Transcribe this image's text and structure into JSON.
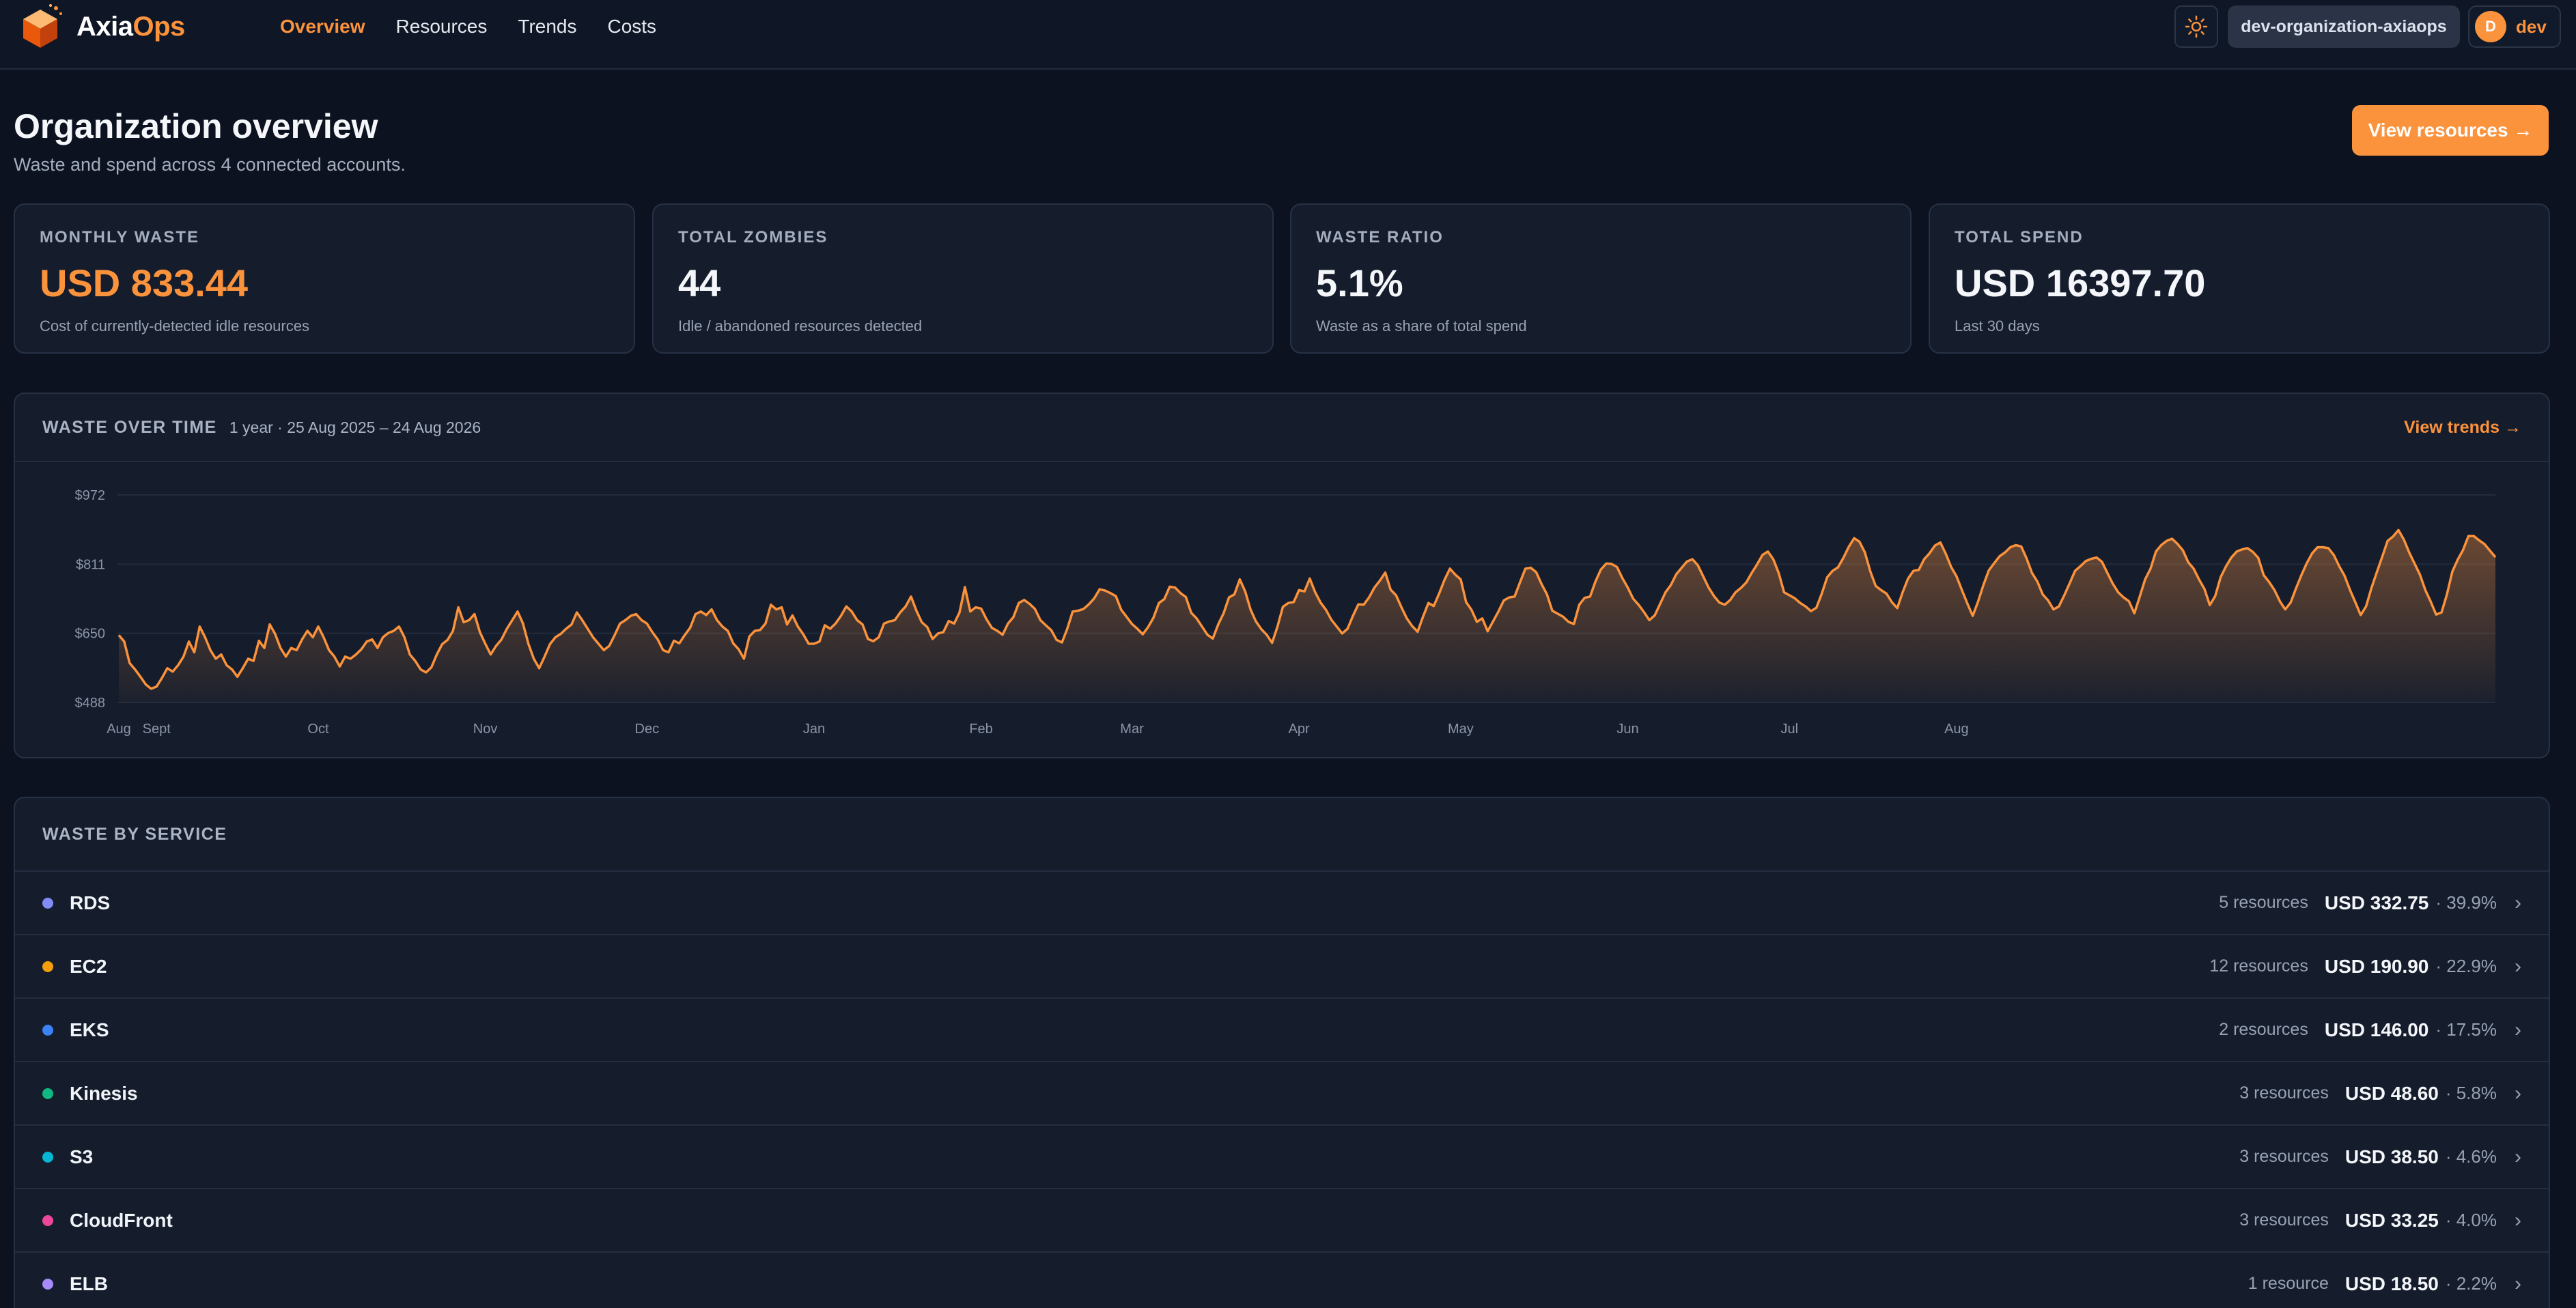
{
  "app": {
    "name_part1": "Axia",
    "name_part2": "Ops"
  },
  "nav": [
    {
      "label": "Overview",
      "active": true
    },
    {
      "label": "Resources",
      "active": false
    },
    {
      "label": "Trends",
      "active": false
    },
    {
      "label": "Costs",
      "active": false
    }
  ],
  "header": {
    "org": "dev-organization-axiaops",
    "user_initial": "D",
    "user_name": "dev",
    "theme_icon": "sun-icon"
  },
  "page": {
    "title": "Organization overview",
    "subtitle": "Waste and spend across 4 connected accounts.",
    "action": "View resources →"
  },
  "stats": [
    {
      "label": "MONTHLY WASTE",
      "value": "USD 833.44",
      "note": "Cost of currently-detected idle resources",
      "highlight": true
    },
    {
      "label": "TOTAL ZOMBIES",
      "value": "44",
      "note": "Idle / abandoned resources detected",
      "highlight": false
    },
    {
      "label": "WASTE RATIO",
      "value": "5.1%",
      "note": "Waste as a share of total spend",
      "highlight": false
    },
    {
      "label": "TOTAL SPEND",
      "value": "USD 16397.70",
      "note": "Last 30 days",
      "highlight": false
    }
  ],
  "chart_panel": {
    "title": "WASTE OVER TIME",
    "range": "1 year · 25 Aug 2025 – 24 Aug 2026",
    "link": "View trends →"
  },
  "chart_data": {
    "type": "area",
    "title": "WASTE OVER TIME",
    "y_ticks": [
      "$972",
      "$811",
      "$650",
      "$488"
    ],
    "ylim": [
      488,
      972
    ],
    "x_ticks": [
      {
        "label": "Aug",
        "day": 0
      },
      {
        "label": "Sept",
        "day": 7
      },
      {
        "label": "Oct",
        "day": 37
      },
      {
        "label": "Nov",
        "day": 68
      },
      {
        "label": "Dec",
        "day": 98
      },
      {
        "label": "Jan",
        "day": 129
      },
      {
        "label": "Feb",
        "day": 160
      },
      {
        "label": "Mar",
        "day": 188
      },
      {
        "label": "Apr",
        "day": 219
      },
      {
        "label": "May",
        "day": 249
      },
      {
        "label": "Jun",
        "day": 280
      },
      {
        "label": "Jul",
        "day": 310
      },
      {
        "label": "Aug",
        "day": 341
      }
    ],
    "series": [
      {
        "color": "#fb923c",
        "values": [
          645,
          630,
          580,
          565,
          548,
          530,
          520,
          525,
          545,
          568,
          560,
          575,
          595,
          630,
          605,
          665,
          640,
          610,
          590,
          600,
          575,
          565,
          548,
          568,
          590,
          585,
          632,
          615,
          670,
          648,
          615,
          595,
          615,
          610,
          635,
          655,
          640,
          665,
          640,
          610,
          595,
          572,
          595,
          590,
          600,
          612,
          630,
          635,
          615,
          640,
          650,
          655,
          665,
          640,
          600,
          585,
          565,
          558,
          570,
          600,
          624,
          634,
          655,
          710,
          675,
          680,
          694,
          652,
          625,
          600,
          620,
          635,
          660,
          680,
          700,
          672,
          625,
          590,
          568,
          595,
          624,
          640,
          648,
          660,
          670,
          698,
          680,
          660,
          640,
          625,
          610,
          620,
          645,
          672,
          680,
          690,
          694,
          680,
          672,
          652,
          635,
          610,
          605,
          632,
          626,
          645,
          662,
          694,
          700,
          692,
          705,
          680,
          665,
          655,
          626,
          612,
          590,
          642,
          655,
          657,
          672,
          716,
          705,
          710,
          670,
          691,
          665,
          647,
          625,
          625,
          630,
          668,
          660,
          672,
          690,
          712,
          700,
          680,
          670,
          636,
          631,
          640,
          672,
          677,
          680,
          698,
          712,
          735,
          702,
          675,
          664,
          636,
          649,
          652,
          678,
          672,
          698,
          757,
          700,
          710,
          707,
          682,
          662,
          655,
          646,
          672,
          687,
          720,
          727,
          718,
          706,
          680,
          668,
          657,
          634,
          628,
          660,
          700,
          702,
          706,
          717,
          731,
          752,
          749,
          743,
          736,
          704,
          688,
          671,
          660,
          647,
          664,
          686,
          720,
          729,
          758,
          756,
          743,
          734,
          697,
          684,
          665,
          646,
          637,
          670,
          696,
          733,
          740,
          775,
          747,
          705,
          677,
          659,
          646,
          627,
          665,
          711,
          720,
          722,
          750,
          747,
          777,
          745,
          721,
          704,
          681,
          665,
          649,
          660,
          690,
          717,
          716,
          733,
          756,
          772,
          791,
          751,
          738,
          710,
          684,
          666,
          653,
          688,
          720,
          713,
          742,
          774,
          800,
          786,
          775,
          722,
          704,
          676,
          684,
          654,
          677,
          700,
          726,
          733,
          735,
          768,
          800,
          802,
          792,
          764,
          740,
          702,
          695,
          688,
          676,
          671,
          716,
          732,
          735,
          770,
          798,
          812,
          811,
          804,
          778,
          756,
          730,
          716,
          699,
          680,
          691,
          718,
          745,
          762,
          787,
          802,
          817,
          822,
          808,
          782,
          756,
          736,
          721,
          716,
          727,
          745,
          755,
          768,
          790,
          810,
          832,
          840,
          822,
          790,
          745,
          738,
          731,
          720,
          712,
          701,
          709,
          742,
          780,
          795,
          803,
          825,
          851,
          871,
          863,
          838,
          794,
          760,
          750,
          742,
          722,
          708,
          745,
          777,
          795,
          797,
          822,
          836,
          854,
          861,
          835,
          804,
          782,
          750,
          719,
          690,
          723,
          762,
          796,
          813,
          829,
          838,
          850,
          855,
          852,
          824,
          790,
          770,
          740,
          726,
          705,
          712,
          738,
          766,
          795,
          806,
          818,
          823,
          826,
          816,
          790,
          765,
          745,
          733,
          724,
          696,
          735,
          775,
          800,
          840,
          855,
          865,
          870,
          858,
          843,
          815,
          800,
          775,
          753,
          715,
          736,
          780,
          805,
          826,
          840,
          845,
          848,
          839,
          825,
          785,
          769,
          750,
          724,
          705,
          721,
          754,
          785,
          813,
          836,
          850,
          850,
          848,
          832,
          806,
          784,
          751,
          722,
          692,
          712,
          755,
          792,
          828,
          865,
          875,
          890,
          868,
          838,
          812,
          786,
          750,
          723,
          693,
          698,
          740,
          793,
          821,
          844,
          876,
          876,
          866,
          857,
          842,
          827
        ]
      }
    ]
  },
  "services": {
    "title": "WASTE BY SERVICE",
    "rows": [
      {
        "name": "RDS",
        "count": "5 resources",
        "amount": "USD 332.75",
        "pct": "· 39.9%",
        "color": "#818cf8"
      },
      {
        "name": "EC2",
        "count": "12 resources",
        "amount": "USD 190.90",
        "pct": "· 22.9%",
        "color": "#f59e0b"
      },
      {
        "name": "EKS",
        "count": "2 resources",
        "amount": "USD 146.00",
        "pct": "· 17.5%",
        "color": "#3b82f6"
      },
      {
        "name": "Kinesis",
        "count": "3 resources",
        "amount": "USD 48.60",
        "pct": "· 5.8%",
        "color": "#10b981"
      },
      {
        "name": "S3",
        "count": "3 resources",
        "amount": "USD 38.50",
        "pct": "· 4.6%",
        "color": "#06b6d4"
      },
      {
        "name": "CloudFront",
        "count": "3 resources",
        "amount": "USD 33.25",
        "pct": "· 4.0%",
        "color": "#ec4899"
      },
      {
        "name": "ELB",
        "count": "1 resource",
        "amount": "USD 18.50",
        "pct": "· 2.2%",
        "color": "#a78bfa"
      }
    ]
  }
}
